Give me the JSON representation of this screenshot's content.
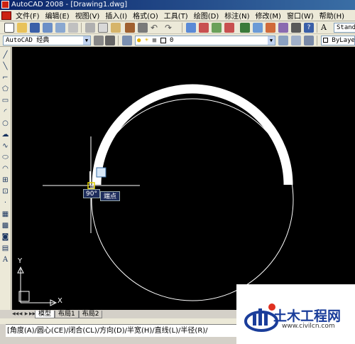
{
  "window": {
    "title": "AutoCAD 2008 - [Drawing1.dwg]"
  },
  "menubar": {
    "items": [
      "文件(F)",
      "编辑(E)",
      "视图(V)",
      "插入(I)",
      "格式(O)",
      "工具(T)",
      "绘图(D)",
      "标注(N)",
      "修改(M)",
      "窗口(W)",
      "帮助(H)"
    ]
  },
  "toolbar": {
    "text_style": "Stand",
    "workspace": "AutoCAD 经典",
    "layer_name": "0",
    "color": "ByLayer"
  },
  "drawing": {
    "background_color": "#000000",
    "polar_angle": "90°",
    "osnap_tooltip": "端点",
    "ucs_x_label": "X",
    "ucs_y_label": "Y"
  },
  "layout_tabs": {
    "model": "模型",
    "layout1": "布局1",
    "layout2": "布局2"
  },
  "command_line": {
    "text": "[角度(A)/圆心(CE)/闭合(CL)/方向(D)/半宽(H)/直线(L)/半径(R)/"
  },
  "watermark": {
    "title": "土木工程网",
    "url": "www.civilcn.com"
  }
}
